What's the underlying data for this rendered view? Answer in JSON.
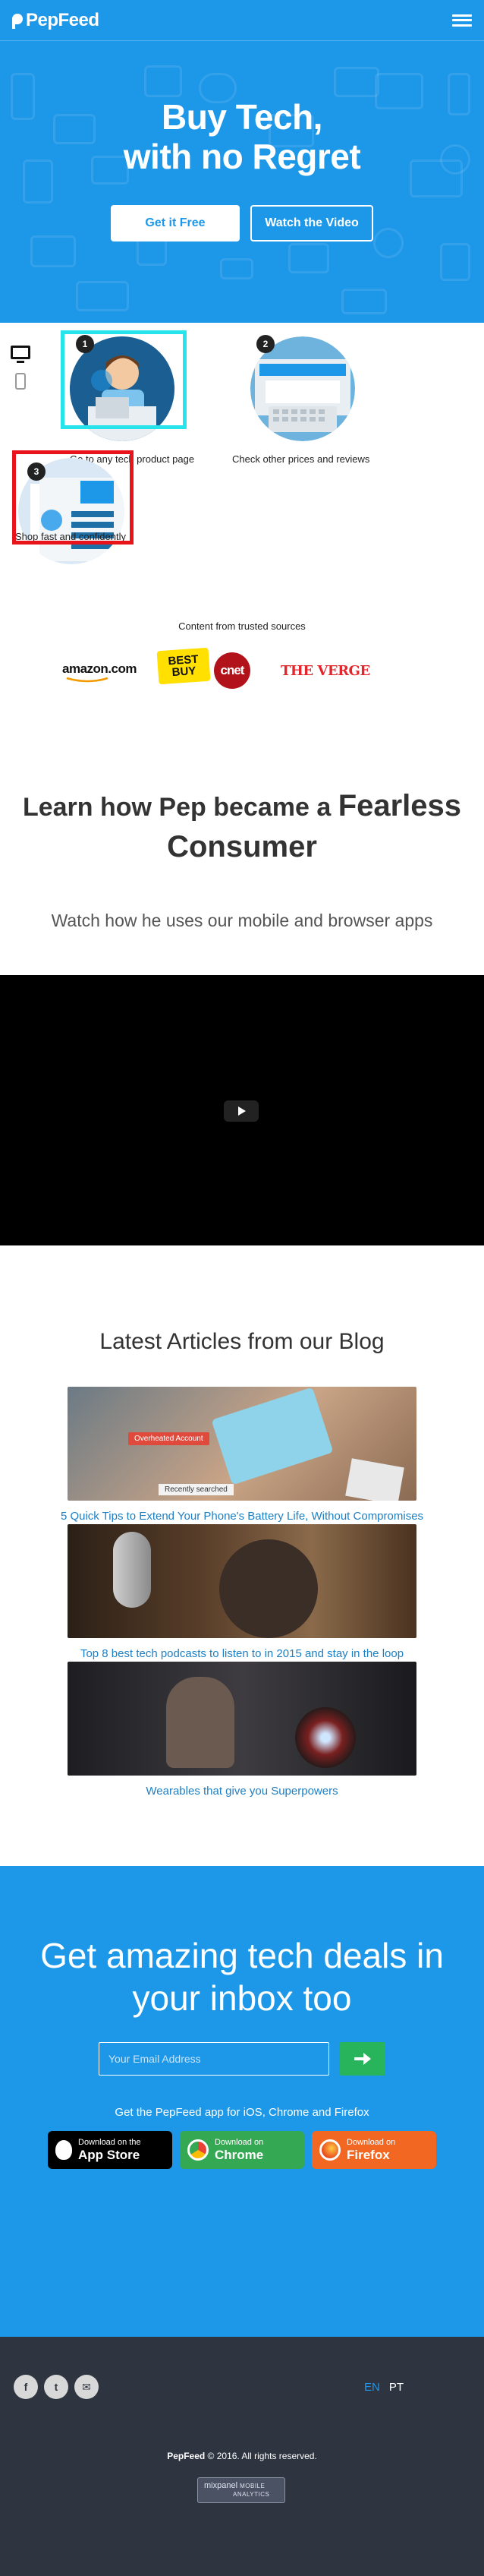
{
  "header": {
    "logo_text": "PepFeed",
    "menu_icon": "hamburger-menu-icon"
  },
  "hero": {
    "title_line1": "Buy Tech,",
    "title_line2": "with no Regret",
    "primary_button": "Get it Free",
    "secondary_button": "Watch the Video",
    "background_color": "#1d97e8"
  },
  "steps": {
    "device_icons": [
      "desktop-icon",
      "phone-icon"
    ],
    "items": [
      {
        "number": "1",
        "label": "Go to any tech product page"
      },
      {
        "number": "2",
        "label": "Check other prices and reviews"
      },
      {
        "number": "3",
        "label": "Shop fast and confidently"
      }
    ]
  },
  "sources": {
    "title": "Content from trusted sources",
    "logos": [
      "amazon.com",
      "BEST BUY",
      "cnet",
      "THE VERGE"
    ]
  },
  "learn": {
    "title_prefix": "Learn how Pep became a",
    "title_bold": "Fearless Consumer",
    "subtitle": "Watch how he uses our mobile and browser apps"
  },
  "video": {
    "play_icon": "play-icon"
  },
  "blog": {
    "title": "Latest Articles from our Blog",
    "articles": [
      {
        "title": "5 Quick Tips to Extend Your Phone's Battery Life, Without Compromises",
        "overlay_1": "Overheated Account",
        "overlay_2": "Recently searched"
      },
      {
        "title": "Top 8 best tech podcasts to listen to in 2015 and stay in the loop"
      },
      {
        "title": "Wearables that give you Superpowers"
      }
    ]
  },
  "newsletter": {
    "title": "Get amazing tech deals in your inbox too",
    "email_placeholder": "Your Email Address",
    "submit_icon": "arrow-right-icon",
    "apps_text": "Get the PepFeed app for iOS, Chrome and Firefox",
    "stores": [
      {
        "small": "Download on the",
        "big": "App Store",
        "icon": "apple-icon"
      },
      {
        "small": "Download on",
        "big": "Chrome",
        "icon": "chrome-icon"
      },
      {
        "small": "Download on",
        "big": "Firefox",
        "icon": "firefox-icon"
      }
    ]
  },
  "footer": {
    "social": [
      "f",
      "t",
      "✉"
    ],
    "social_icons": [
      "facebook-icon",
      "twitter-icon",
      "email-icon"
    ],
    "lang_en": "EN",
    "lang_pt": "PT",
    "brand": "PepFeed",
    "copyright": "© 2016. All rights reserved.",
    "badge_brand": "mixpanel",
    "badge_sub1": "MOBILE",
    "badge_sub2": "ANALYTICS",
    "accent_color": "#1d97e8",
    "background_color": "#2f3540"
  }
}
